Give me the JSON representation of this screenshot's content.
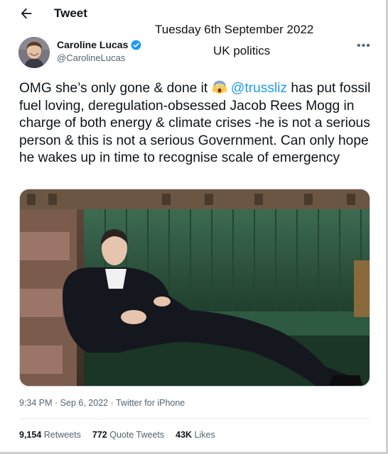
{
  "header": {
    "title": "Tweet",
    "back_icon": "arrow-left-icon"
  },
  "overlay": {
    "date": "Tuesday 6th September 2022",
    "topic": "UK politics"
  },
  "author": {
    "name": "Caroline Lucas",
    "handle": "@CarolineLucas",
    "verified_icon": "verified-badge-icon",
    "verified_color": "#1d9bf0"
  },
  "more_icon": "more-horizontal-icon",
  "tweet": {
    "part1": "OMG she’s only gone & done it ",
    "emoji": "screaming-face-emoji",
    "mention": "@trussliz",
    "part2": " has put fossil fuel loving, deregulation-obsessed Jacob Rees Mogg in charge of both energy & climate crises -he is not a serious person & this is not a serious Government. Can only hope he wakes up in time to recognise scale of emergency"
  },
  "meta": {
    "time": "9:34 PM",
    "date": "Sep 6, 2022",
    "source": "Twitter for iPhone"
  },
  "stats": {
    "retweets_count": "9,154",
    "retweets_label": "Retweets",
    "quotes_count": "772",
    "quotes_label": "Quote Tweets",
    "likes_count": "43K",
    "likes_label": "Likes"
  },
  "colors": {
    "link": "#1d9bf0",
    "secondary_text": "#536471",
    "bench_green": "#2f5a42"
  }
}
